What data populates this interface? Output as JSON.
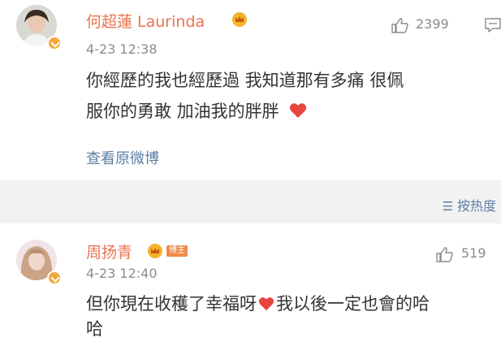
{
  "posts": [
    {
      "author": "何超蓮 Laurinda",
      "time": "4-23 12:38",
      "likes": "2399",
      "content_line1": "你經歷的我也經歷過 我知道那有多痛 很佩",
      "content_line2": "服你的勇敢 加油我的胖胖",
      "view_original": "查看原微博"
    }
  ],
  "sort_label": "按热度",
  "comments": [
    {
      "author": "周扬青",
      "badge": "博主",
      "time": "4-23 12:40",
      "likes": "519",
      "content_line1_a": "但你現在收穫了幸福呀",
      "content_line1_b": "我以後一定也會的哈",
      "content_line2": "哈"
    }
  ],
  "colors": {
    "name": "#eb7350",
    "link": "#5d7ea6",
    "heart": "#e8453c",
    "verified": "#f3a93a"
  }
}
